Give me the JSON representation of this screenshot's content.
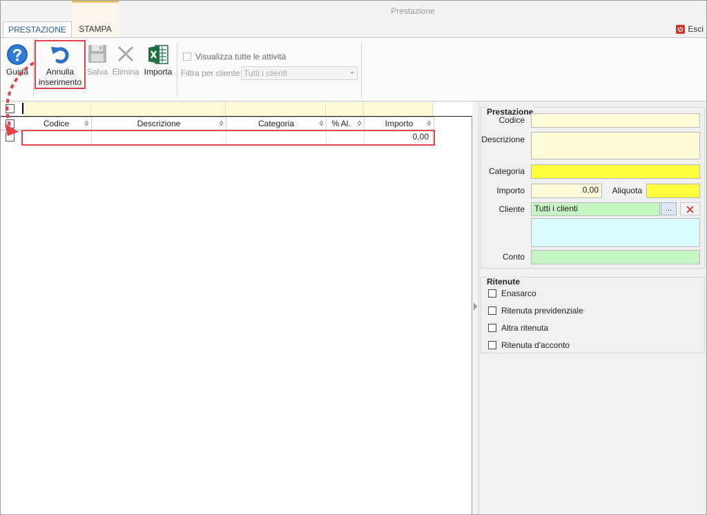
{
  "window": {
    "title": "Prestazione"
  },
  "tabs": [
    {
      "label": "PRESTAZIONE",
      "active": true
    },
    {
      "label": "STAMPA",
      "active": false
    }
  ],
  "esci_label": "Esci",
  "ribbon": {
    "guida": "Guida",
    "annulla_line1": "Annulla",
    "annulla_line2": "inserimento",
    "salva": "Salva",
    "elimina": "Elimina",
    "importa": "Importa",
    "visualizza_label": "Visualizza tutte le attività",
    "filtra_label": "Filtra per cliente",
    "filtra_value": "Tutti i clienti"
  },
  "grid": {
    "columns": [
      {
        "label": "Codice",
        "sort": "◊"
      },
      {
        "label": "Descrizione",
        "sort": "◊"
      },
      {
        "label": "Categoria",
        "sort": "◊"
      },
      {
        "label": "% Al.",
        "sort": "◊"
      },
      {
        "label": "Importo",
        "sort": "◊"
      }
    ],
    "rows": [
      {
        "codice": "",
        "descrizione": "",
        "categoria": "",
        "aliquota": "",
        "importo": "0,00"
      }
    ]
  },
  "detail": {
    "prestazione_title": "Prestazione",
    "labels": {
      "codice": "Codice",
      "descrizione": "Descrizione",
      "categoria": "Categoria",
      "importo": "Importo",
      "aliquota": "Aliquota",
      "cliente": "Cliente",
      "conto": "Conto"
    },
    "values": {
      "codice": "",
      "descrizione": "",
      "categoria": "",
      "importo": "0,00",
      "aliquota": "",
      "cliente": "Tutti i clienti",
      "cliente_extra": "",
      "conto": ""
    },
    "ellipsis_label": "...",
    "ritenute_title": "Ritenute",
    "ritenute": [
      {
        "label": "Enasarco",
        "checked": false
      },
      {
        "label": "Ritenuta previdenziale",
        "checked": false
      },
      {
        "label": "Altra ritenuta",
        "checked": false
      },
      {
        "label": "Ritenuta d'acconto",
        "checked": false
      }
    ]
  },
  "colors": {
    "accent_blue": "#2a5ca8",
    "highlight_red": "#e0444a",
    "field_cream": "#fffbd9",
    "field_yellow": "#ffff3f",
    "field_green": "#c5f5c2",
    "field_cyan": "#dafbff"
  }
}
